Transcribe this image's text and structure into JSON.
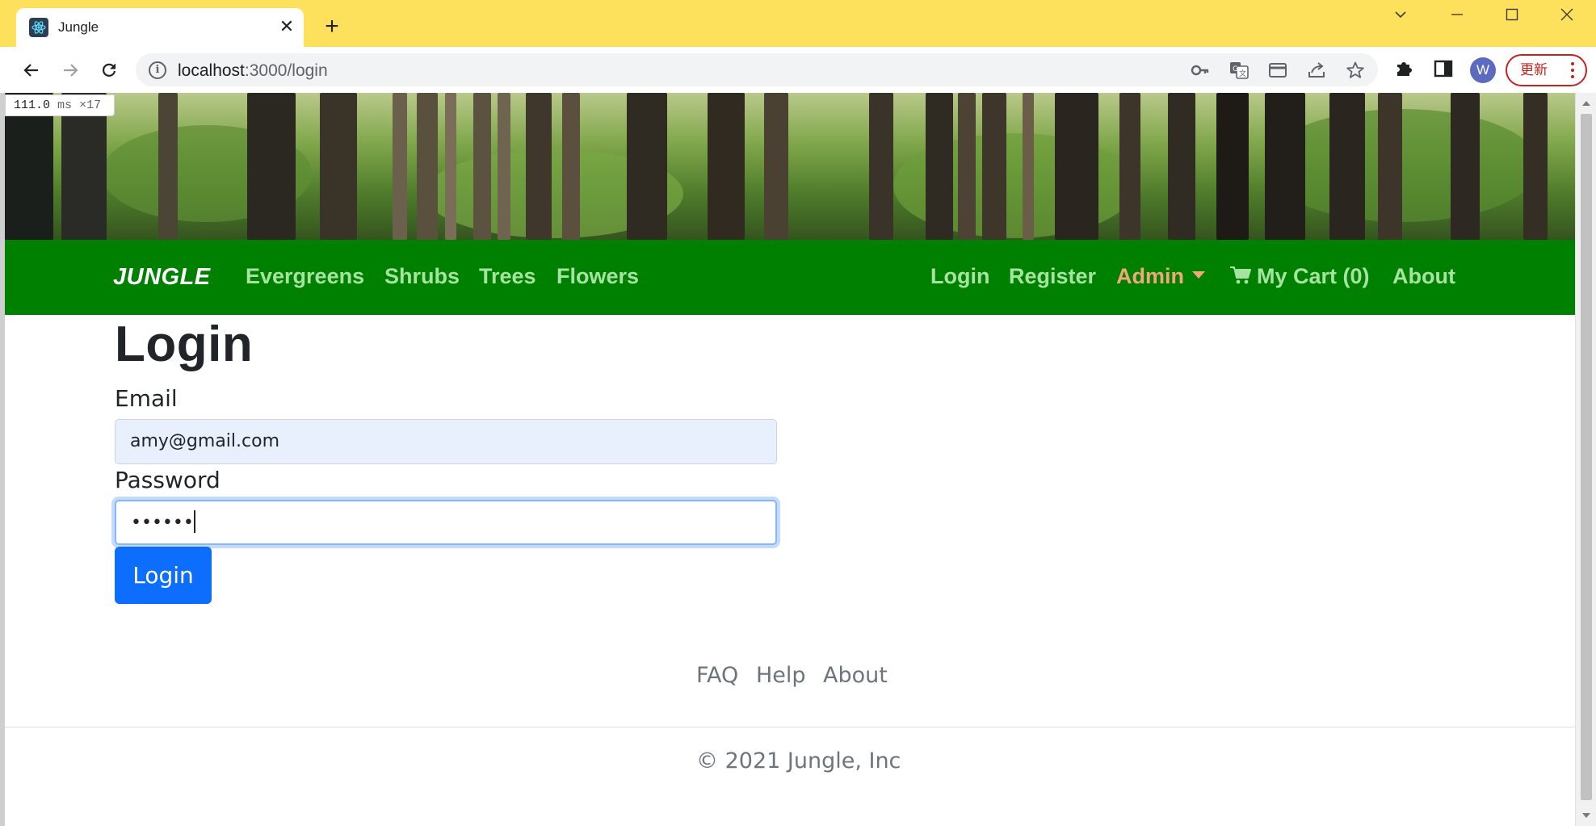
{
  "browser": {
    "tab_title": "Jungle",
    "url_host": "localhost",
    "url_rest": ":3000/login",
    "avatar_letter": "W",
    "update_label": "更新"
  },
  "devtools": {
    "value": "111.0",
    "unit": "ms",
    "count": "×17"
  },
  "navbar": {
    "brand": "JUNGLE",
    "left_links": [
      "Evergreens",
      "Shrubs",
      "Trees",
      "Flowers"
    ],
    "login": "Login",
    "register": "Register",
    "admin": "Admin",
    "cart": "My Cart (0)",
    "about": "About"
  },
  "form": {
    "title": "Login",
    "email_label": "Email",
    "email_value": "amy@gmail.com",
    "password_label": "Password",
    "password_value": "••••••",
    "submit_label": "Login"
  },
  "footer": {
    "links": [
      "FAQ",
      "Help",
      "About"
    ],
    "copyright": "© 2021 Jungle, Inc"
  },
  "colors": {
    "navbar_bg": "#008000",
    "nav_link": "#a7e3a0",
    "admin_link": "#f0a87a",
    "primary_button": "#0d6efd",
    "tabbar": "#fde05c"
  }
}
